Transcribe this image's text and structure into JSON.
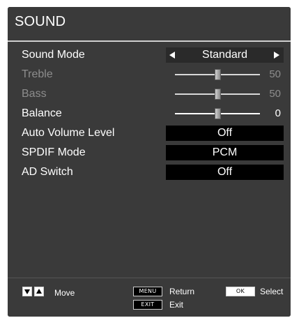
{
  "title": "SOUND",
  "menu": {
    "sound_mode": {
      "label": "Sound Mode",
      "value": "Standard"
    },
    "treble": {
      "label": "Treble",
      "value": "50",
      "level": 0.5
    },
    "bass": {
      "label": "Bass",
      "value": "50",
      "level": 0.5
    },
    "balance": {
      "label": "Balance",
      "value": "0",
      "level": 0.5
    },
    "auto_volume": {
      "label": "Auto Volume Level",
      "value": "Off"
    },
    "spdif": {
      "label": "SPDIF Mode",
      "value": "PCM"
    },
    "ad_switch": {
      "label": "AD Switch",
      "value": "Off"
    }
  },
  "footer": {
    "move_label": "Move",
    "menu_key": "MENU",
    "return_label": "Return",
    "ok_key": "OK",
    "select_label": "Select",
    "exit_key": "EXIT",
    "exit_label": "Exit"
  },
  "colors": {
    "panel": "#3a3a3a",
    "disabled_text": "#8d8d8d",
    "value_box": "#000000"
  }
}
